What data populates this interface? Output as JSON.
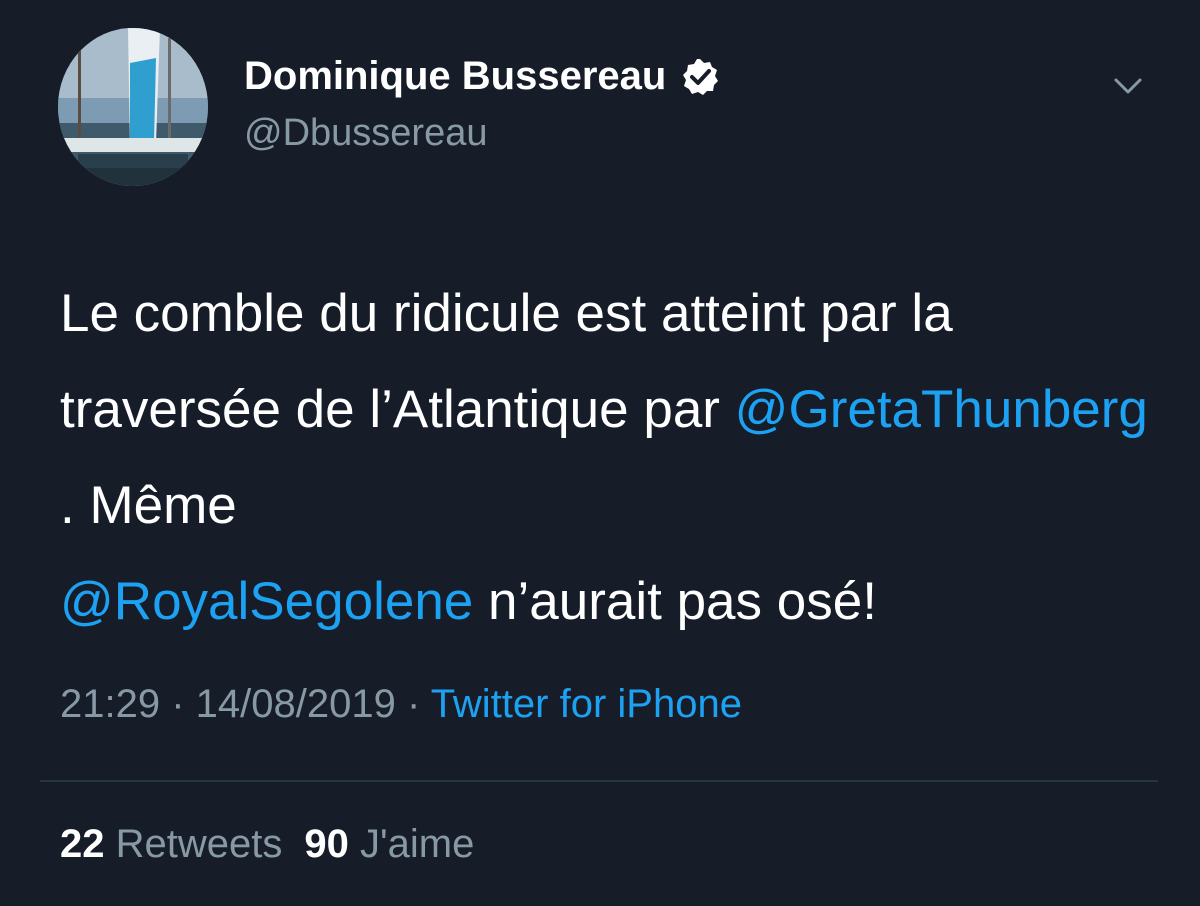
{
  "user": {
    "display_name": "Dominique Bussereau",
    "handle": "@Dbussereau",
    "verified": true
  },
  "tweet": {
    "text_part1": "Le comble du ridicule est atteint par la traversée de l’Atlantique par ",
    "mention1": "@GretaThunberg",
    "text_part2": " . Même ",
    "mention2": "@RoyalSegolene",
    "text_part3": " n’aurait pas osé!",
    "time": "21:29",
    "date": "14/08/2019",
    "separator": " · ",
    "source": "Twitter for iPhone"
  },
  "stats": {
    "retweets_count": "22",
    "retweets_label": "Retweets",
    "likes_count": "90",
    "likes_label": "J'aime"
  },
  "colors": {
    "background": "#161d28",
    "accent": "#1da1f2",
    "secondary_text": "#8899a6"
  },
  "icons": {
    "verified": "verified-badge-icon",
    "menu": "chevron-down-icon"
  }
}
